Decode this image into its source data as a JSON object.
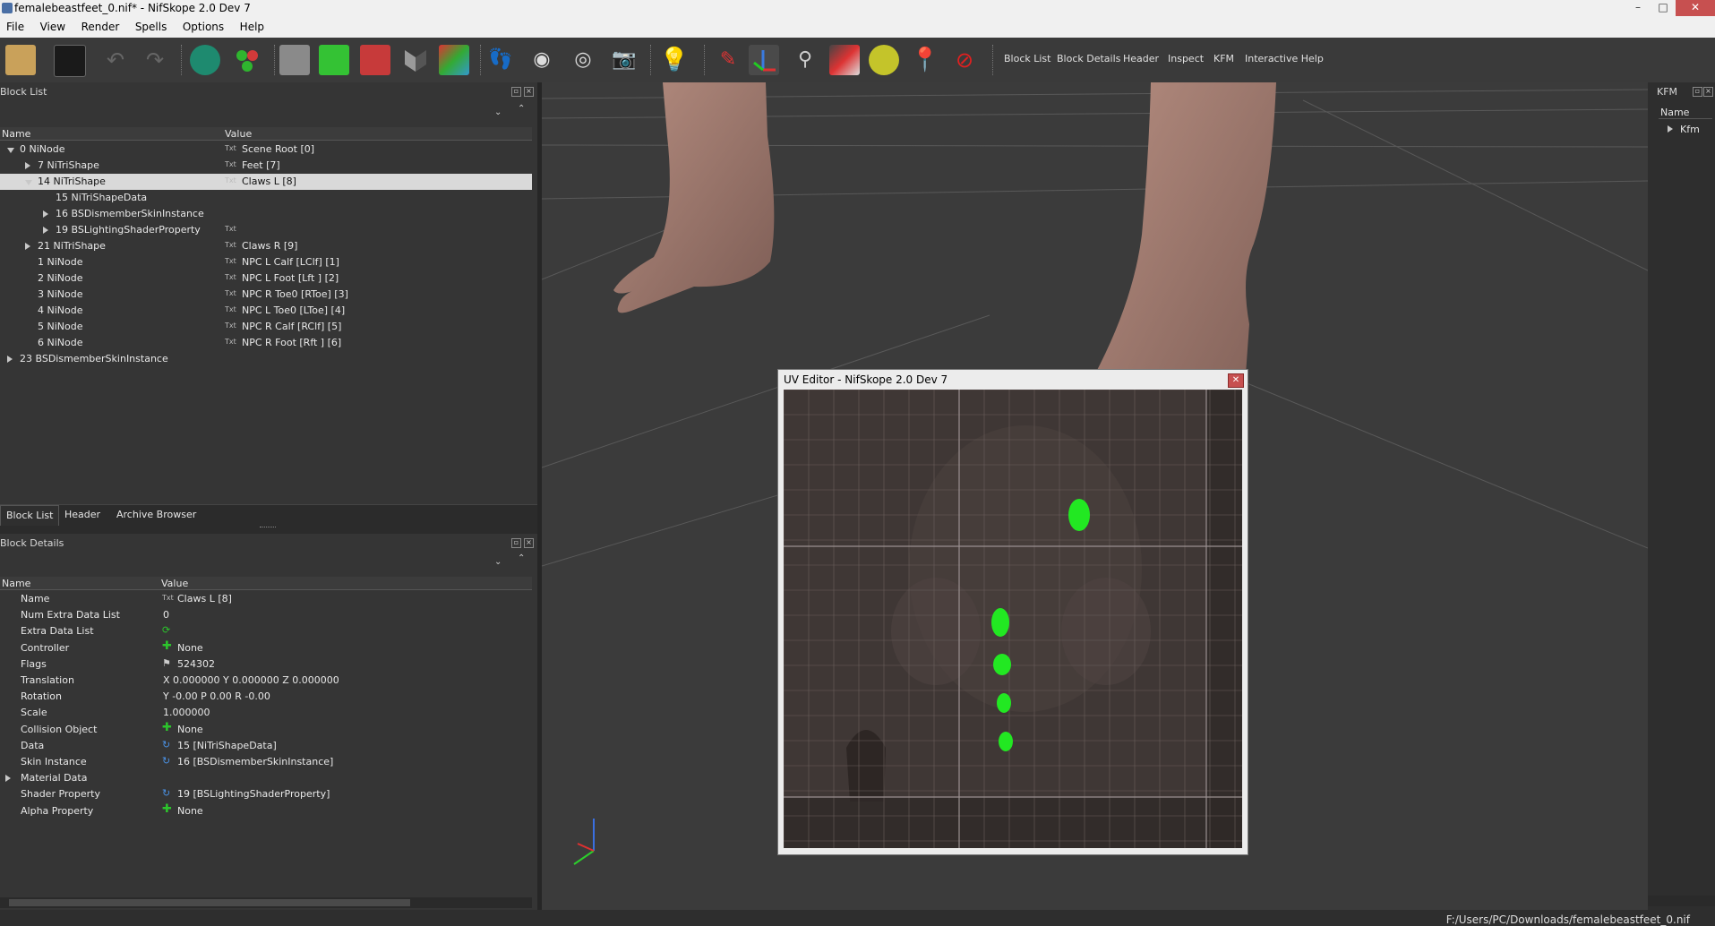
{
  "window": {
    "title": "femalebeastfeet_0.nif* - NifSkope 2.0 Dev 7"
  },
  "menu": [
    "File",
    "View",
    "Render",
    "Spells",
    "Options",
    "Help"
  ],
  "toolbar": {
    "text_buttons": [
      "Block List",
      "Block Details",
      "Header",
      "Inspect",
      "KFM",
      "Interactive Help"
    ]
  },
  "block_list": {
    "title": "Block List",
    "columns": [
      "Name",
      "Value"
    ],
    "rows": [
      {
        "name": "0 NiNode",
        "value": "Scene Root [0]"
      },
      {
        "name": "7 NiTriShape",
        "value": "Feet [7]"
      },
      {
        "name": "14 NiTriShape",
        "value": "Claws L [8]"
      },
      {
        "name": "15 NiTriShapeData",
        "value": ""
      },
      {
        "name": "16 BSDismemberSkinInstance",
        "value": ""
      },
      {
        "name": "19 BSLightingShaderProperty",
        "value": ""
      },
      {
        "name": "21 NiTriShape",
        "value": "Claws R [9]"
      },
      {
        "name": "1 NiNode",
        "value": "NPC L Calf [LClf] [1]"
      },
      {
        "name": "2 NiNode",
        "value": "NPC L Foot [Lft ] [2]"
      },
      {
        "name": "3 NiNode",
        "value": "NPC R Toe0 [RToe] [3]"
      },
      {
        "name": "4 NiNode",
        "value": "NPC L Toe0 [LToe] [4]"
      },
      {
        "name": "5 NiNode",
        "value": "NPC R Calf [RClf] [5]"
      },
      {
        "name": "6 NiNode",
        "value": "NPC R Foot [Rft ] [6]"
      },
      {
        "name": "23 BSDismemberSkinInstance",
        "value": ""
      }
    ],
    "tabs": [
      "Block List",
      "Header",
      "Archive Browser"
    ]
  },
  "block_details": {
    "title": "Block Details",
    "columns": [
      "Name",
      "Value"
    ],
    "rows": [
      {
        "name": "Name",
        "value": "Claws L [8]"
      },
      {
        "name": "Num Extra Data List",
        "value": "0"
      },
      {
        "name": "Extra Data List",
        "value": ""
      },
      {
        "name": "Controller",
        "value": "None"
      },
      {
        "name": "Flags",
        "value": "524302"
      },
      {
        "name": "Translation",
        "value": "X 0.000000 Y 0.000000 Z 0.000000"
      },
      {
        "name": "Rotation",
        "value": "Y -0.00 P 0.00 R -0.00"
      },
      {
        "name": "Scale",
        "value": "1.000000"
      },
      {
        "name": "Collision Object",
        "value": "None"
      },
      {
        "name": "Data",
        "value": "15 [NiTriShapeData]"
      },
      {
        "name": "Skin Instance",
        "value": "16 [BSDismemberSkinInstance]"
      },
      {
        "name": "Material Data",
        "value": ""
      },
      {
        "name": "Shader Property",
        "value": "19 [BSLightingShaderProperty]"
      },
      {
        "name": "Alpha Property",
        "value": "None"
      }
    ]
  },
  "kfm": {
    "title": "KFM",
    "column": "Name",
    "item": "Kfm"
  },
  "uv_editor": {
    "title": "UV Editor - NifSkope 2.0 Dev 7"
  },
  "status": {
    "path": "F:/Users/PC/Downloads/femalebeastfeet_0.nif"
  },
  "colors": {
    "uv_points": "#22e822",
    "selection": "#d9d9d9"
  }
}
